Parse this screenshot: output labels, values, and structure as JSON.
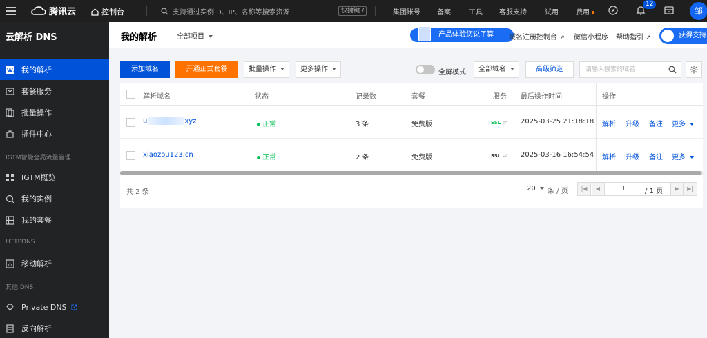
{
  "topbar": {
    "brand": "腾讯云",
    "console": "控制台",
    "search_placeholder": "支持通过实例ID、IP、名称等搜索资源",
    "shortcut": "快捷键 /",
    "links": [
      "集团账号",
      "备案",
      "工具",
      "客服支持",
      "试用",
      "费用"
    ],
    "notification_count": "12",
    "avatar_text": "邹"
  },
  "sidebar": {
    "title": "云解析 DNS",
    "items": [
      {
        "label": "我的解析",
        "icon": "domain-icon",
        "active": true
      },
      {
        "label": "套餐服务",
        "icon": "package-icon"
      },
      {
        "label": "批量操作",
        "icon": "batch-icon"
      },
      {
        "label": "插件中心",
        "icon": "plugin-icon"
      }
    ],
    "group_igtm": "IGTM智能全局流量管理",
    "igtm_items": [
      {
        "label": "IGTM概览",
        "icon": "grid-icon"
      },
      {
        "label": "我的实例",
        "icon": "instance-icon"
      },
      {
        "label": "我的套餐",
        "icon": "list-icon"
      }
    ],
    "group_httpdns": "HTTPDNS",
    "httpdns_items": [
      {
        "label": "移动解析",
        "icon": "chart-icon"
      }
    ],
    "group_other": "其他 DNS",
    "other_items": [
      {
        "label": "Private DNS",
        "icon": "diamond-icon"
      },
      {
        "label": "反向解析",
        "icon": "doc-icon"
      }
    ]
  },
  "header": {
    "title": "我的解析",
    "project": "全部项目",
    "experience_banner": "产品体验您说了算",
    "links": [
      "域名注册控制台",
      "微信小程序",
      "帮助指引"
    ],
    "support": "获得支持"
  },
  "toolbar": {
    "add_domain": "添加域名",
    "upgrade": "开通正式套餐",
    "batch_ops": "批量操作",
    "more_ops": "更多操作",
    "fullscreen": "全屏模式",
    "domain_filter": "全部域名",
    "advanced_filter": "高级筛选",
    "search_placeholder": "请输入搜索的域名"
  },
  "table": {
    "headers": [
      "解析域名",
      "状态",
      "记录数",
      "套餐",
      "服务",
      "最后操作时间",
      "操作"
    ],
    "rows": [
      {
        "domain_prefix": "u",
        "domain_suffix": "xyz",
        "status": "正常",
        "records": "3 条",
        "plan": "免费版",
        "service": "SSL",
        "time": "2025-03-25 21:18:18"
      },
      {
        "domain_prefix": "xiaozou123.cn",
        "domain_suffix": "",
        "status": "正常",
        "records": "2 条",
        "plan": "免费版",
        "service": "SSL",
        "time": "2025-03-16 16:54:54"
      }
    ],
    "actions": [
      "解析",
      "升级",
      "备注",
      "更多"
    ]
  },
  "pagination": {
    "total": "共 2 条",
    "page_size": "20",
    "page_size_unit": "条 / 页",
    "current_page": "1",
    "total_pages": "/ 1 页"
  }
}
